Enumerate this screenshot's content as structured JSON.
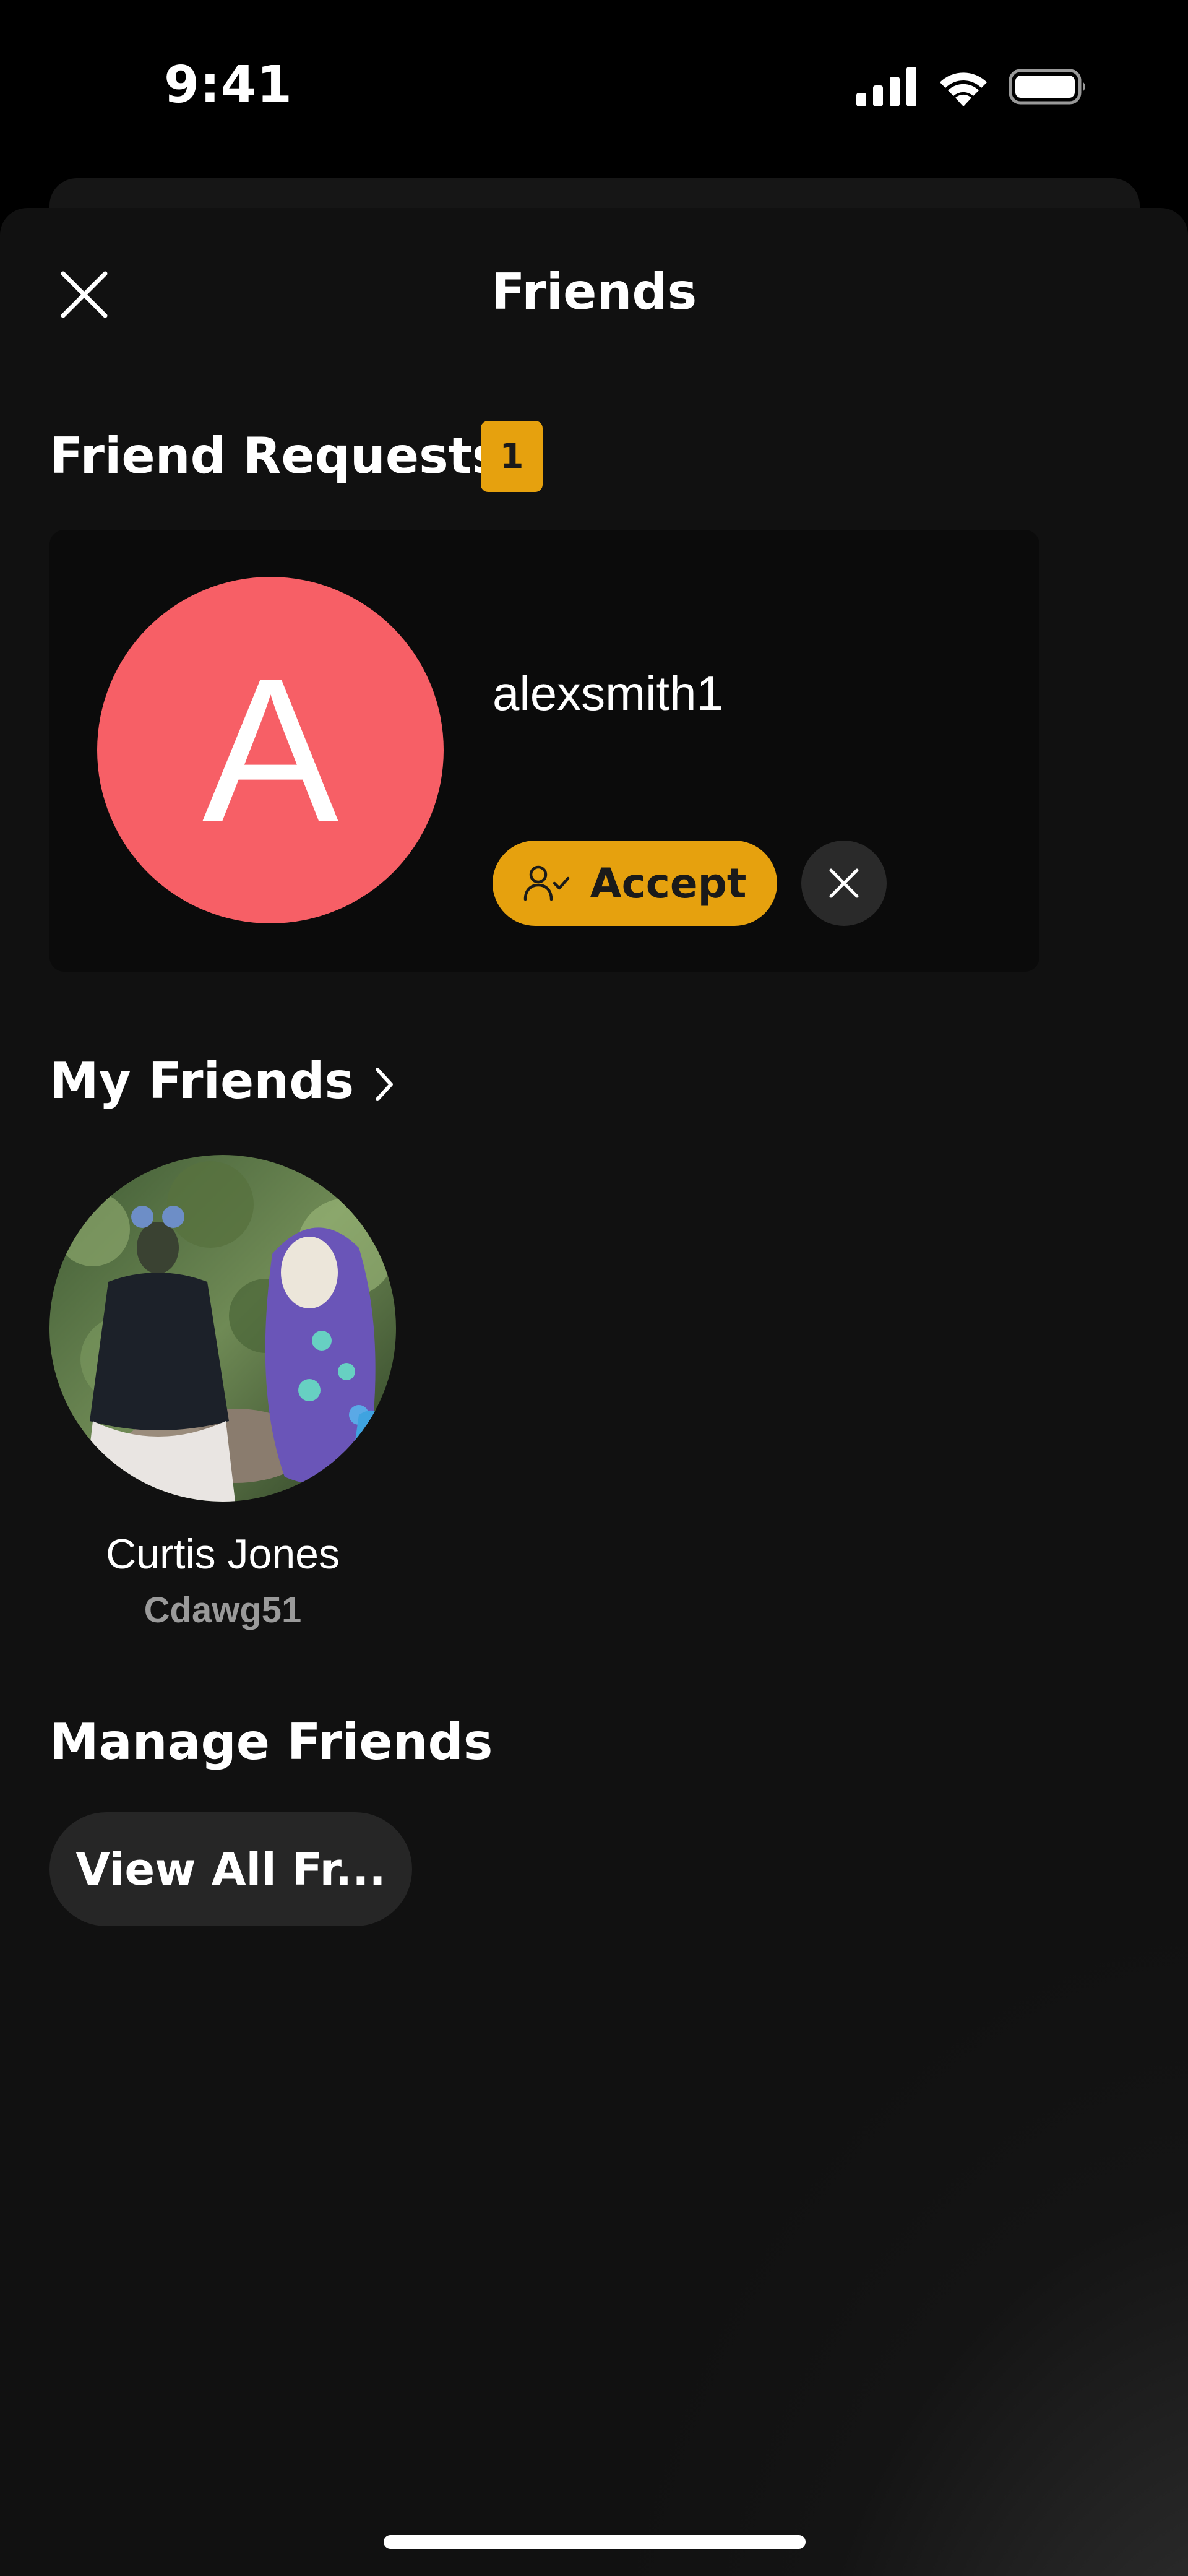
{
  "status_bar": {
    "time": "9:41",
    "icons": [
      "cellular-signal-icon",
      "wifi-icon",
      "battery-icon"
    ]
  },
  "header": {
    "title": "Friends",
    "close_icon": "close-icon"
  },
  "friend_requests": {
    "title": "Friend Requests",
    "count": "1",
    "requests": [
      {
        "avatar_letter": "A",
        "avatar_color": "#f75f66",
        "username": "alexsmith1",
        "accept_label": "Accept",
        "accept_icon": "user-check-icon",
        "decline_icon": "close-icon"
      }
    ]
  },
  "my_friends": {
    "title": "My Friends",
    "chevron_icon": "chevron-right-icon",
    "friends": [
      {
        "name": "Curtis Jones",
        "handle": "Cdawg51"
      }
    ]
  },
  "manage_friends": {
    "title": "Manage Friends",
    "view_all_label": "View All Fr..."
  },
  "colors": {
    "accent": "#e6a10e",
    "background": "#111111",
    "card": "#0b0b0b",
    "button_dark": "#262626"
  }
}
